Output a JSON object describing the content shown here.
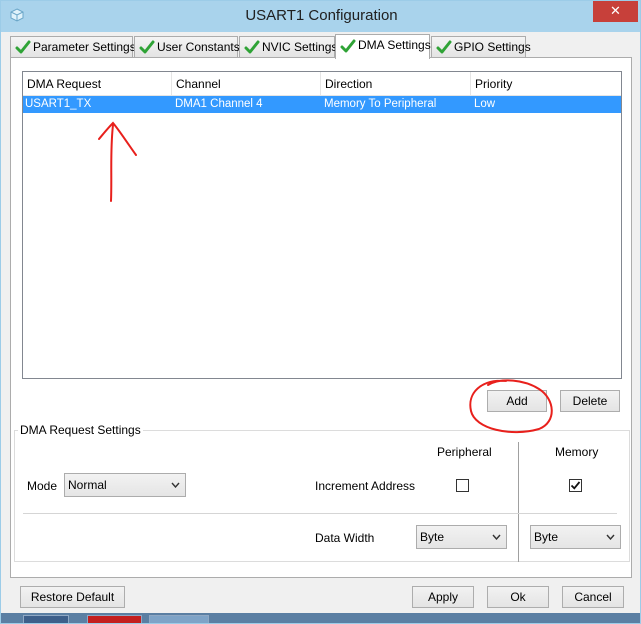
{
  "window": {
    "title": "USART1 Configuration",
    "close_glyph": "✕"
  },
  "tabs": [
    {
      "label": "Parameter Settings"
    },
    {
      "label": "User Constants"
    },
    {
      "label": "NVIC Settings"
    },
    {
      "label": "DMA Settings"
    },
    {
      "label": "GPIO Settings"
    }
  ],
  "table": {
    "columns": [
      "DMA Request",
      "Channel",
      "Direction",
      "Priority"
    ],
    "rows": [
      {
        "request": "USART1_TX",
        "channel": "DMA1 Channel 4",
        "direction": "Memory To Peripheral",
        "priority": "Low"
      }
    ]
  },
  "buttons": {
    "add": "Add",
    "delete": "Delete",
    "restore_default": "Restore Default",
    "apply": "Apply",
    "ok": "Ok",
    "cancel": "Cancel"
  },
  "dma_settings": {
    "group_title": "DMA Request Settings",
    "mode_label": "Mode",
    "mode_value": "Normal",
    "peripheral_header": "Peripheral",
    "memory_header": "Memory",
    "increment_label": "Increment Address",
    "peripheral_increment": false,
    "memory_increment": true,
    "data_width_label": "Data Width",
    "peripheral_width": "Byte",
    "memory_width": "Byte"
  },
  "colors": {
    "selection": "#3399ff",
    "annotation": "#e8201c",
    "titlebar": "#a9d3ec",
    "close": "#c7403a"
  }
}
